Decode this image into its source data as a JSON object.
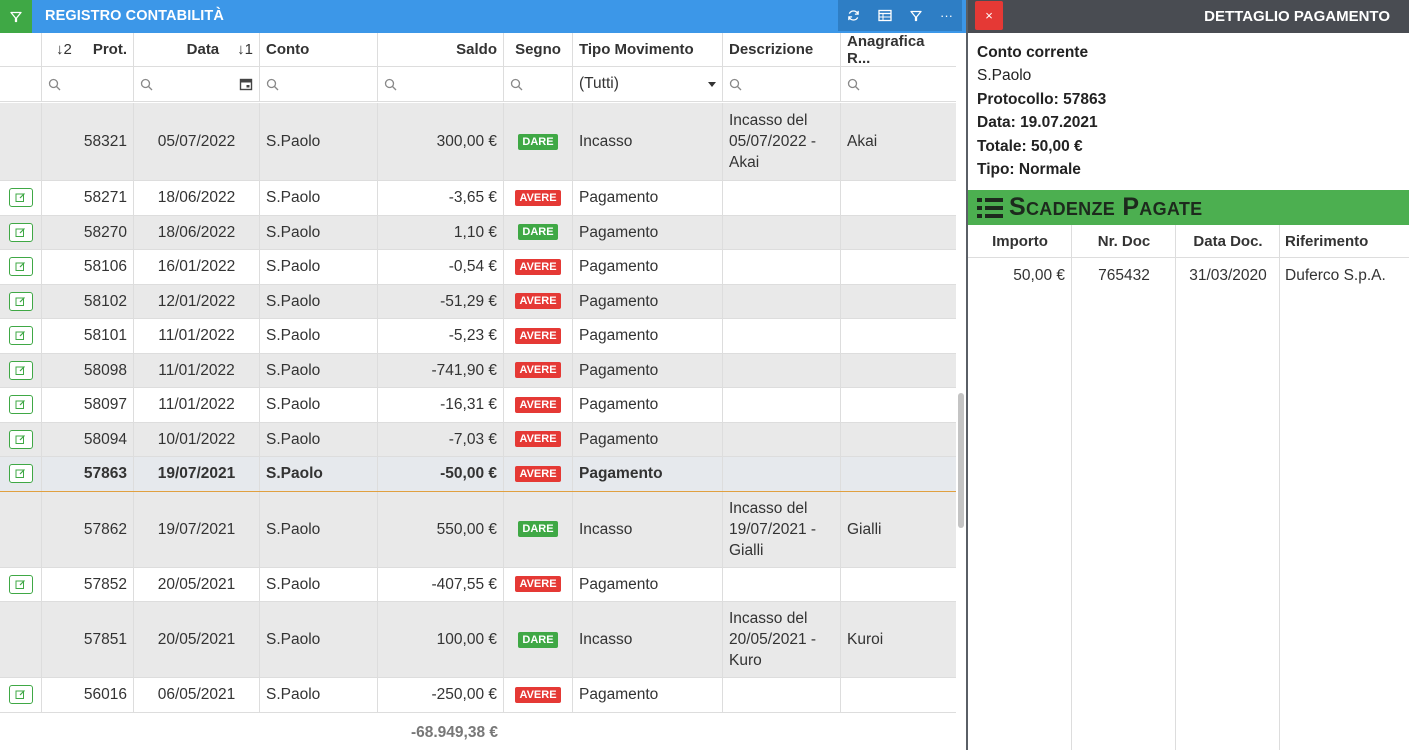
{
  "left_panel": {
    "title": "REGISTRO CONTABILITÀ",
    "columns": {
      "prot": "Prot.",
      "prot_sort": "↓2",
      "data": "Data",
      "data_sort": "↓1",
      "conto": "Conto",
      "saldo": "Saldo",
      "segno": "Segno",
      "tipo": "Tipo Movimento",
      "descrizione": "Descrizione",
      "anagrafica": "Anagrafica R..."
    },
    "filter": {
      "tipo_value": "(Tutti)"
    },
    "rows": [
      {
        "prot": "58321",
        "data": "05/07/2022",
        "conto": "S.Paolo",
        "saldo": "300,00 €",
        "segno": "DARE",
        "tipo": "Incasso",
        "descrizione": "Incasso del 05/07/2022 - Akai",
        "anagrafica": "Akai"
      },
      {
        "prot": "58271",
        "data": "18/06/2022",
        "conto": "S.Paolo",
        "saldo": "-3,65 €",
        "segno": "AVERE",
        "tipo": "Pagamento",
        "descrizione": "",
        "anagrafica": ""
      },
      {
        "prot": "58270",
        "data": "18/06/2022",
        "conto": "S.Paolo",
        "saldo": "1,10 €",
        "segno": "DARE",
        "tipo": "Pagamento",
        "descrizione": "",
        "anagrafica": ""
      },
      {
        "prot": "58106",
        "data": "16/01/2022",
        "conto": "S.Paolo",
        "saldo": "-0,54 €",
        "segno": "AVERE",
        "tipo": "Pagamento",
        "descrizione": "",
        "anagrafica": ""
      },
      {
        "prot": "58102",
        "data": "12/01/2022",
        "conto": "S.Paolo",
        "saldo": "-51,29 €",
        "segno": "AVERE",
        "tipo": "Pagamento",
        "descrizione": "",
        "anagrafica": ""
      },
      {
        "prot": "58101",
        "data": "11/01/2022",
        "conto": "S.Paolo",
        "saldo": "-5,23 €",
        "segno": "AVERE",
        "tipo": "Pagamento",
        "descrizione": "",
        "anagrafica": ""
      },
      {
        "prot": "58098",
        "data": "11/01/2022",
        "conto": "S.Paolo",
        "saldo": "-741,90 €",
        "segno": "AVERE",
        "tipo": "Pagamento",
        "descrizione": "",
        "anagrafica": ""
      },
      {
        "prot": "58097",
        "data": "11/01/2022",
        "conto": "S.Paolo",
        "saldo": "-16,31 €",
        "segno": "AVERE",
        "tipo": "Pagamento",
        "descrizione": "",
        "anagrafica": ""
      },
      {
        "prot": "58094",
        "data": "10/01/2022",
        "conto": "S.Paolo",
        "saldo": "-7,03 €",
        "segno": "AVERE",
        "tipo": "Pagamento",
        "descrizione": "",
        "anagrafica": ""
      },
      {
        "prot": "57863",
        "data": "19/07/2021",
        "conto": "S.Paolo",
        "saldo": "-50,00 €",
        "segno": "AVERE",
        "tipo": "Pagamento",
        "descrizione": "",
        "anagrafica": ""
      },
      {
        "prot": "57862",
        "data": "19/07/2021",
        "conto": "S.Paolo",
        "saldo": "550,00 €",
        "segno": "DARE",
        "tipo": "Incasso",
        "descrizione": "Incasso del 19/07/2021 - Gialli",
        "anagrafica": "Gialli"
      },
      {
        "prot": "57852",
        "data": "20/05/2021",
        "conto": "S.Paolo",
        "saldo": "-407,55 €",
        "segno": "AVERE",
        "tipo": "Pagamento",
        "descrizione": "",
        "anagrafica": ""
      },
      {
        "prot": "57851",
        "data": "20/05/2021",
        "conto": "S.Paolo",
        "saldo": "100,00 €",
        "segno": "DARE",
        "tipo": "Incasso",
        "descrizione": "Incasso del 20/05/2021 - Kuro",
        "anagrafica": "Kuroi"
      },
      {
        "prot": "56016",
        "data": "06/05/2021",
        "conto": "S.Paolo",
        "saldo": "-250,00 €",
        "segno": "AVERE",
        "tipo": "Pagamento",
        "descrizione": "",
        "anagrafica": ""
      }
    ],
    "footer_total": "-68.949,38 €"
  },
  "right_panel": {
    "title": "DETTAGLIO PAGAMENTO",
    "close_label": "×",
    "info": {
      "account_type": "Conto corrente",
      "account_name": "S.Paolo",
      "protocollo": "Protocollo: 57863",
      "data": "Data: 19.07.2021",
      "totale": "Totale: 50,00 €",
      "tipo": "Tipo: Normale"
    },
    "section_title": "Scadenze Pagate",
    "table": {
      "headers": [
        "Importo",
        "Nr. Doc",
        "Data Doc.",
        "Riferimento"
      ],
      "rows": [
        [
          "50,00 €",
          "765432",
          "31/03/2020",
          "Duferco S.p.A."
        ]
      ]
    }
  },
  "colors": {
    "title_bar": "#3c97e8",
    "dare": "#3fa845",
    "avere": "#e53935",
    "section_green": "#4caf50",
    "right_header": "#494c52"
  }
}
